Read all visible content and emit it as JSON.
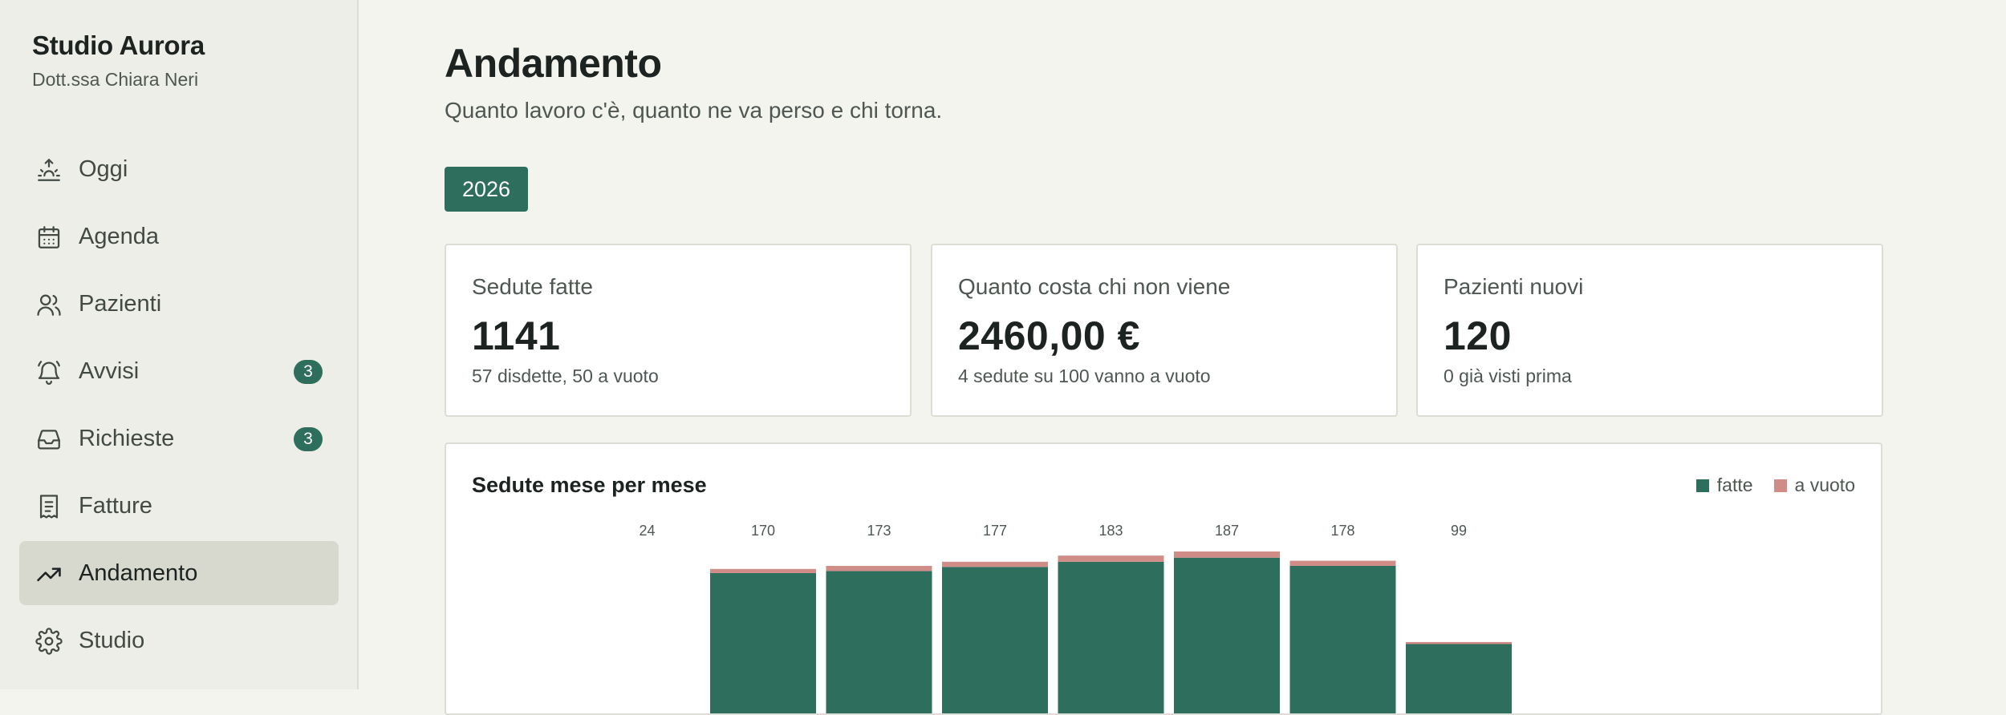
{
  "sidebar": {
    "brand_name": "Studio Aurora",
    "brand_sub": "Dott.ssa Chiara Neri",
    "items": [
      {
        "label": "Oggi",
        "icon": "sunrise-icon"
      },
      {
        "label": "Agenda",
        "icon": "calendar-icon"
      },
      {
        "label": "Pazienti",
        "icon": "users-icon"
      },
      {
        "label": "Avvisi",
        "icon": "bell-icon",
        "badge": "3"
      },
      {
        "label": "Richieste",
        "icon": "inbox-icon",
        "badge": "3"
      },
      {
        "label": "Fatture",
        "icon": "receipt-icon"
      },
      {
        "label": "Andamento",
        "icon": "trending-up-icon",
        "active": true
      },
      {
        "label": "Studio",
        "icon": "gear-icon"
      }
    ]
  },
  "header": {
    "title": "Andamento",
    "subtitle": "Quanto lavoro c'è, quanto ne va perso e chi torna."
  },
  "year_selector": {
    "label": "2026"
  },
  "cards": [
    {
      "label": "Sedute fatte",
      "value": "1141",
      "note": "57 disdette, 50 a vuoto"
    },
    {
      "label": "Quanto costa chi non viene",
      "value": "2460,00 €",
      "note": "4 sedute su 100 vanno a vuoto"
    },
    {
      "label": "Pazienti nuovi",
      "value": "120",
      "note": "0 già visti prima"
    }
  ],
  "colors": {
    "accent": "#2e6e5d",
    "missed": "#d08c86"
  },
  "chart_data": {
    "type": "bar",
    "stacked": true,
    "title": "Sedute mese per mese",
    "legend": [
      "fatte",
      "a vuoto"
    ],
    "legend_position": "top-right",
    "grid": false,
    "categories": [
      "",
      "",
      "",
      "",
      "",
      "",
      "",
      "",
      "",
      "",
      "",
      ""
    ],
    "data_labels": [
      "",
      "24",
      "170",
      "173",
      "177",
      "183",
      "187",
      "178",
      "99",
      "",
      "",
      ""
    ],
    "series": [
      {
        "name": "fatte",
        "color": "#2e6e5d",
        "values": [
          0,
          23,
          166,
          168,
          172,
          177,
          181,
          173,
          97,
          0,
          0,
          0
        ]
      },
      {
        "name": "a vuoto",
        "color": "#d08c86",
        "values": [
          0,
          1,
          4,
          5,
          5,
          6,
          6,
          5,
          2,
          0,
          0,
          0
        ]
      }
    ],
    "ylim": [
      0,
      187
    ]
  }
}
